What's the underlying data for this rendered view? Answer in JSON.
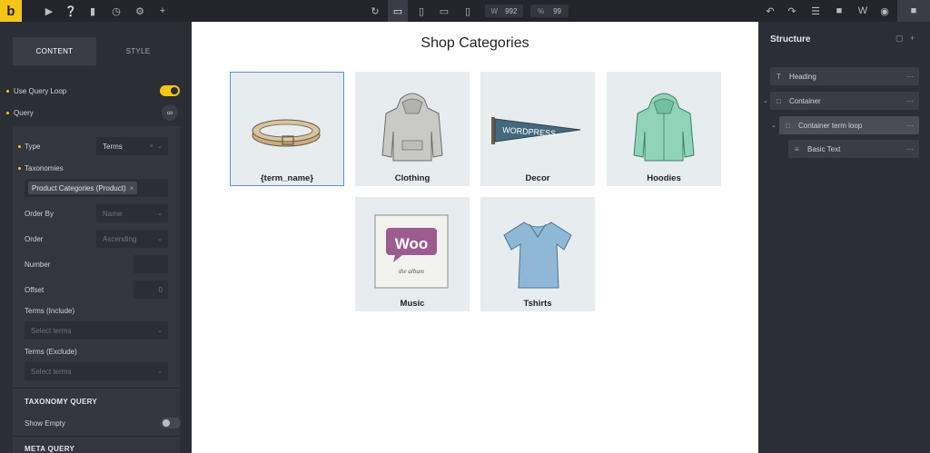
{
  "topbar": {
    "logo": "b",
    "width_label": "W",
    "width_value": "992",
    "percent_label": "%",
    "percent_value": "99",
    "icons_left": [
      "cursor-icon",
      "help-icon",
      "pages-icon",
      "history-icon",
      "settings-icon",
      "plus-icon"
    ],
    "icons_center": [
      "undo-reload-icon",
      "desktop-icon",
      "tablet-portrait-icon",
      "tablet-landscape-icon",
      "mobile-icon"
    ],
    "icons_right": [
      "undo-icon",
      "redo-icon",
      "layers-icon",
      "folder-icon",
      "wordpress-icon",
      "preview-icon",
      "save-icon"
    ]
  },
  "left_panel": {
    "tab_content": "CONTENT",
    "tab_style": "STYLE",
    "use_query_loop": "Use Query Loop",
    "query": "Query",
    "type_label": "Type",
    "type_value": "Terms",
    "taxonomies_label": "Taxonomies",
    "taxonomies_chip": "Product Categories (Product)",
    "order_by_label": "Order By",
    "order_by_value": "Name",
    "order_label": "Order",
    "order_value": "Ascending",
    "number_label": "Number",
    "number_value": "",
    "offset_label": "Offset",
    "offset_value": "0",
    "terms_include_label": "Terms (Include)",
    "terms_include_placeholder": "Select terms",
    "terms_exclude_label": "Terms (Exclude)",
    "terms_exclude_placeholder": "Select terms",
    "taxonomy_query": "TAXONOMY QUERY",
    "show_empty": "Show Empty",
    "meta_query": "META QUERY"
  },
  "canvas": {
    "title": "Shop Categories",
    "cards": [
      {
        "label": "{term_name}"
      },
      {
        "label": "Clothing"
      },
      {
        "label": "Decor"
      },
      {
        "label": "Hoodies"
      },
      {
        "label": "Music"
      },
      {
        "label": "Tshirts"
      }
    ],
    "music_art_text": "Woo",
    "music_art_subtext": "the album",
    "pennant_text": "WORDPRESS"
  },
  "structure": {
    "title": "Structure",
    "nodes": [
      {
        "label": "Heading",
        "icon": "heading-icon"
      },
      {
        "label": "Container",
        "icon": "container-icon"
      },
      {
        "label": "Container term loop",
        "icon": "container-icon"
      },
      {
        "label": "Basic Text",
        "icon": "text-icon"
      }
    ]
  },
  "colors": {
    "accent": "#f5c518",
    "panel": "#2b2e35",
    "selection": "#5a8fe0"
  }
}
